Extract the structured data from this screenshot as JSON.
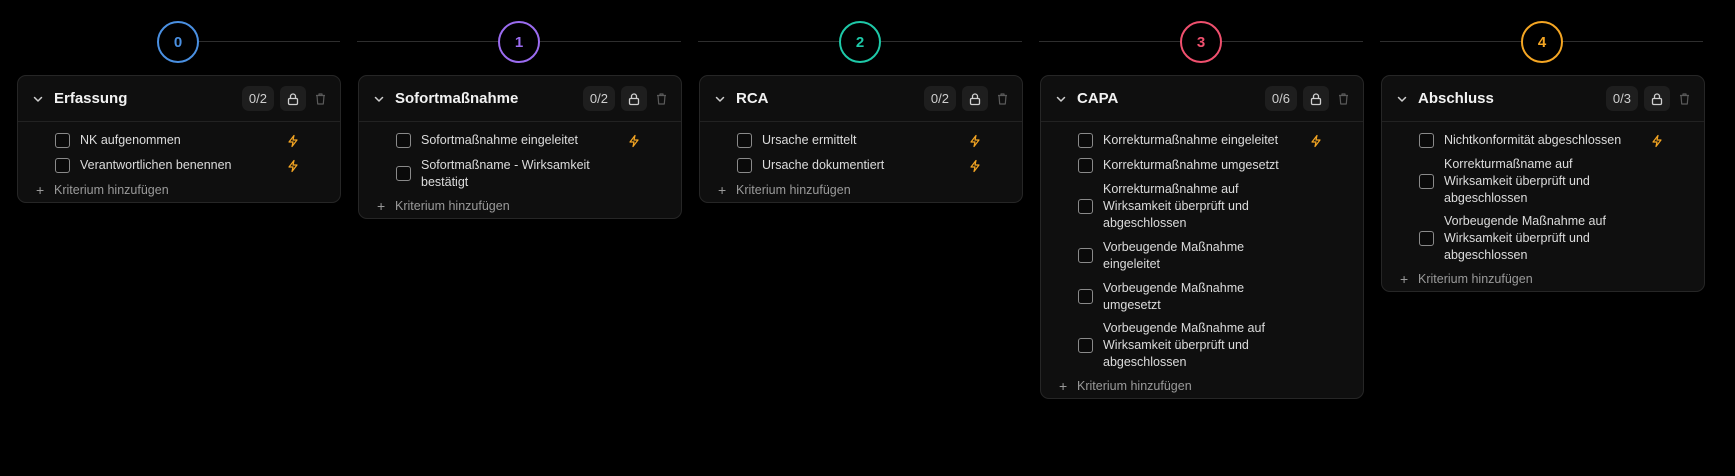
{
  "phases": [
    {
      "step": "0",
      "color": "#4a90e2",
      "title": "Erfassung",
      "count": "0/2",
      "criteria": [
        {
          "label": "NK aufgenommen",
          "auto": true
        },
        {
          "label": "Verantwortlichen benennen",
          "auto": true
        }
      ],
      "add_label": "Kriterium hinzufügen"
    },
    {
      "step": "1",
      "color": "#9b6cf0",
      "title": "Sofortmaßnahme",
      "count": "0/2",
      "criteria": [
        {
          "label": "Sofortmaßnahme eingeleitet",
          "auto": true
        },
        {
          "label": "Sofortmaßname - Wirksamkeit bestätigt",
          "auto": false
        }
      ],
      "add_label": "Kriterium hinzufügen"
    },
    {
      "step": "2",
      "color": "#1ec9a8",
      "title": "RCA",
      "count": "0/2",
      "criteria": [
        {
          "label": "Ursache ermittelt",
          "auto": true
        },
        {
          "label": "Ursache dokumentiert",
          "auto": true
        }
      ],
      "add_label": "Kriterium hinzufügen"
    },
    {
      "step": "3",
      "color": "#f0506e",
      "title": "CAPA",
      "count": "0/6",
      "criteria": [
        {
          "label": "Korrekturmaßnahme eingeleitet",
          "auto": true
        },
        {
          "label": "Korrekturmaßnahme umgesetzt",
          "auto": false
        },
        {
          "label": "Korrekturmaßnahme auf Wirksamkeit überprüft und abgeschlossen",
          "auto": false
        },
        {
          "label": "Vorbeugende Maßnahme eingeleitet",
          "auto": false
        },
        {
          "label": "Vorbeugende Maßnahme umgesetzt",
          "auto": false
        },
        {
          "label": "Vorbeugende Maßnahme auf Wirksamkeit überprüft und abgeschlossen",
          "auto": false
        }
      ],
      "add_label": "Kriterium hinzufügen"
    },
    {
      "step": "4",
      "color": "#f5a623",
      "title": "Abschluss",
      "count": "0/3",
      "criteria": [
        {
          "label": "Nichtkonformität abgeschlossen",
          "auto": true
        },
        {
          "label": "Korrekturmaßname auf Wirksamkeit überprüft und abgeschlossen",
          "auto": false
        },
        {
          "label": "Vorbeugende Maßnahme auf Wirksamkeit überprüft und abgeschlossen",
          "auto": false
        }
      ],
      "add_label": "Kriterium hinzufügen"
    }
  ],
  "icons": {
    "chevron": "chevron-down-icon",
    "lock": "lock-icon",
    "trash": "trash-icon",
    "auto": "lightning-icon",
    "add": "plus-icon"
  },
  "colors": {
    "auto_icon": "#f5a623"
  }
}
